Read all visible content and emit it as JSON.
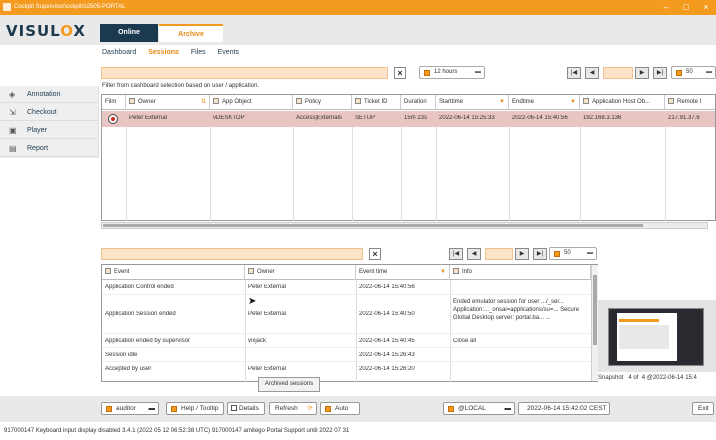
{
  "window": {
    "title": "Cockpit Supervisor\\ockpit/o2505-PORTAL"
  },
  "logo": {
    "text_a": "VISUL",
    "text_x": "O",
    "text_b": "X"
  },
  "top_tabs": [
    {
      "label": "Online"
    },
    {
      "label": "Archive"
    }
  ],
  "subnav": [
    {
      "label": "Dashboard"
    },
    {
      "label": "Sessions"
    },
    {
      "label": "Files"
    },
    {
      "label": "Events"
    }
  ],
  "sidebar": [
    {
      "label": "Annotation",
      "icon": "tag-icon"
    },
    {
      "label": "Checkout",
      "icon": "checkout-icon"
    },
    {
      "label": "Player",
      "icon": "player-icon"
    },
    {
      "label": "Report",
      "icon": "report-icon"
    }
  ],
  "sessions": {
    "filter_hint": "Filter from cashboard selection based on user / application.",
    "time_range": "12 hours",
    "page_size": "50",
    "columns": [
      "Film",
      "Owner",
      "App Object",
      "Policy",
      "Ticket ID",
      "Duration",
      "Starttime",
      "Endtime",
      "Application Host Ob...",
      "Remote I"
    ],
    "rows": [
      {
        "owner": "Peter External",
        "app": "vDESKTOP",
        "policy": "Access|Externals",
        "ticket": "SETUP",
        "duration": "15m 23s",
        "start": "2022-06-14 15:25:33",
        "end": "2022-06-14 15:40:56",
        "host": "192.168.3.136",
        "remote": "217.91.37.6"
      }
    ]
  },
  "events": {
    "page_size": "50",
    "columns": [
      "Event",
      "Owner",
      "Event time",
      "Info"
    ],
    "rows": [
      {
        "event": "Application Control ended",
        "owner": "Peter External",
        "time": "2022-06-14 15:40:56",
        "info": ""
      },
      {
        "event": "Application Session ended",
        "owner": "Peter External",
        "time": "2022-06-14 15:40:50",
        "info": "Ended emulator session for user .../_ser... Application:..._onsai=applications/su=... Secure Global Desktop server: portal.ba... ..."
      },
      {
        "event": "Application ended by supervisor",
        "owner": "vixjack",
        "time": "2022-06-14 15:40:45",
        "info": "Close all"
      },
      {
        "event": "Session idle",
        "owner": "",
        "time": "2022-06-14 15:26:43",
        "info": ""
      },
      {
        "event": "Accepted by user",
        "owner": "Peter External",
        "time": "2022-06-14 15:26:20",
        "info": ""
      }
    ]
  },
  "tooltip": "Archived sessions",
  "snapshot": {
    "label": "Snapshot",
    "of": "4 of",
    "count": "4 @2022-06-14 15:4"
  },
  "bottom": {
    "user": "auditor",
    "help": "Help / Tooltip",
    "details": "Details",
    "refresh": "Refresh",
    "auto": "Auto",
    "server": "@LOCAL",
    "datetime": "2022-06-14 15:42:02 CEST",
    "exit": "Exit"
  },
  "status": "917000147   Keyboard input display disabled   3.4.1 (2022 05 12 06:52:38 UTC)   917000147 amitego Portal   Support until 2022 07 31",
  "colors": {
    "accent": "#f39a1f",
    "selected_row": "#e8c5c3",
    "dark_tab": "#1c3a4f"
  }
}
